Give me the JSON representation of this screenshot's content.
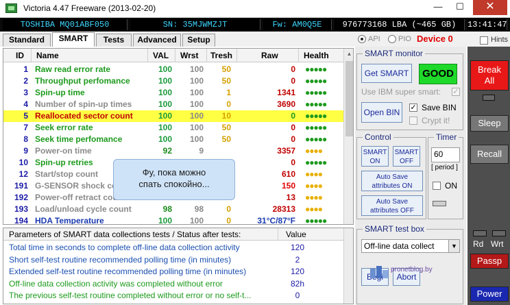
{
  "window": {
    "title": "Victoria 4.47  Freeware (2013-02-20)",
    "minimize": "—",
    "maximize": "☐",
    "close": "✕"
  },
  "info_bar": {
    "model": "TOSHIBA MQ01ABF050",
    "serial": "SN: 35MJWMZJT",
    "firmware": "Fw: AM0Q5E",
    "lba": "976773168 LBA (~465 GB)",
    "clock": "13:41:47"
  },
  "tabs": [
    {
      "label": "Standard"
    },
    {
      "label": "SMART"
    },
    {
      "label": "Tests"
    },
    {
      "label": "Advanced"
    },
    {
      "label": "Setup"
    }
  ],
  "mode": {
    "api": "API",
    "pio": "PIO",
    "device": "Device 0",
    "hints": "Hints"
  },
  "smart_table": {
    "headers": {
      "id": "ID",
      "name": "Name",
      "val": "VAL",
      "wrst": "Wrst",
      "tresh": "Tresh",
      "raw": "Raw",
      "health": "Health"
    },
    "rows": [
      {
        "id": "1",
        "name": "Raw read error rate",
        "val": "100",
        "wrst": "100",
        "tresh": "50",
        "raw": "0",
        "health": "●●●●●",
        "name_color": "#1d9a1d",
        "health_color": "#1d9a1d",
        "raw_color": "#c00000"
      },
      {
        "id": "2",
        "name": "Throughput perfomance",
        "val": "100",
        "wrst": "100",
        "tresh": "50",
        "raw": "0",
        "health": "●●●●●",
        "name_color": "#1d9a1d",
        "health_color": "#1d9a1d",
        "raw_color": "#c00000"
      },
      {
        "id": "3",
        "name": "Spin-up time",
        "val": "100",
        "wrst": "100",
        "tresh": "1",
        "raw": "1341",
        "health": "●●●●●",
        "name_color": "#1d9a1d",
        "health_color": "#1d9a1d",
        "raw_color": "#c00000"
      },
      {
        "id": "4",
        "name": "Number of spin-up times",
        "val": "100",
        "wrst": "100",
        "tresh": "0",
        "raw": "3690",
        "health": "●●●●●",
        "name_color": "#8a8a8a",
        "health_color": "#1d9a1d",
        "raw_color": "#c00000"
      },
      {
        "id": "5",
        "name": "Reallocated sector count",
        "val": "100",
        "wrst": "100",
        "tresh": "10",
        "raw": "0",
        "health": "●●●●●",
        "name_color": "#c00000",
        "health_color": "#1d9a1d",
        "raw_color": "#1d9a1d",
        "highlight": true
      },
      {
        "id": "7",
        "name": "Seek error rate",
        "val": "100",
        "wrst": "100",
        "tresh": "50",
        "raw": "0",
        "health": "●●●●●",
        "name_color": "#1d9a1d",
        "health_color": "#1d9a1d",
        "raw_color": "#c00000"
      },
      {
        "id": "8",
        "name": "Seek time perfomance",
        "val": "100",
        "wrst": "100",
        "tresh": "50",
        "raw": "0",
        "health": "●●●●●",
        "name_color": "#1d9a1d",
        "health_color": "#1d9a1d",
        "raw_color": "#c00000"
      },
      {
        "id": "9",
        "name": "Power-on time",
        "val": "92",
        "wrst": "9",
        "tresh": "",
        "raw": "3357",
        "health": "●●●●",
        "name_color": "#8a8a8a",
        "health_color": "#e8b000",
        "raw_color": "#c00000"
      },
      {
        "id": "10",
        "name": "Spin-up retries",
        "val": "",
        "wrst": "",
        "tresh": "",
        "raw": "0",
        "health": "●●●●●",
        "name_color": "#1d9a1d",
        "health_color": "#1d9a1d",
        "raw_color": "#c00000"
      },
      {
        "id": "12",
        "name": "Start/stop count",
        "val": "",
        "wrst": "",
        "tresh": "",
        "raw": "610",
        "health": "●●●●",
        "name_color": "#8a8a8a",
        "health_color": "#e8b000",
        "raw_color": "#c00000"
      },
      {
        "id": "191",
        "name": "G-SENSOR shock co",
        "val": "",
        "wrst": "",
        "tresh": "",
        "raw": "150",
        "health": "●●●●",
        "name_color": "#8a8a8a",
        "health_color": "#e8b000",
        "raw_color": "#e00000"
      },
      {
        "id": "192",
        "name": "Power-off retract coun",
        "val": "",
        "wrst": "",
        "tresh": "",
        "raw": "13",
        "health": "●●●●",
        "name_color": "#8a8a8a",
        "health_color": "#e8b000",
        "raw_color": "#c00000"
      },
      {
        "id": "193",
        "name": "Load/unload cycle count",
        "val": "98",
        "wrst": "98",
        "tresh": "0",
        "raw": "28313",
        "health": "●●●●",
        "name_color": "#8a8a8a",
        "health_color": "#e8b000",
        "raw_color": "#c00000"
      },
      {
        "id": "194",
        "name": "HDA Temperature",
        "val": "100",
        "wrst": "100",
        "tresh": "0",
        "raw": "31°C/87°F",
        "health": "●●●●●",
        "name_color": "#1a3ab0",
        "health_color": "#1d9a1d",
        "raw_color": "#1a3ab0"
      }
    ]
  },
  "bubble": {
    "line1": "Фу, пока можно",
    "line2": "спать спокойно..."
  },
  "params_table": {
    "header_param": "Parameters of SMART data collections tests / Status after tests:",
    "header_value": "Value",
    "rows": [
      {
        "text": "Total time in seconds to complete off-line data collection activity",
        "value": "120",
        "green": false
      },
      {
        "text": "Short self-test routine recommended polling time (in minutes)",
        "value": "2",
        "green": false
      },
      {
        "text": "Extended self-test routine recommended polling time (in minutes)",
        "value": "120",
        "green": false
      },
      {
        "text": "Off-line data collection activity was completed without error",
        "value": "82h",
        "green": true
      },
      {
        "text": "The previous self-test routine completed without error or no self-t...",
        "value": "0",
        "green": true
      }
    ]
  },
  "smart_monitor": {
    "title": "SMART monitor",
    "get_smart": "Get SMART",
    "status": "GOOD",
    "ibm_label": "Use IBM super smart:",
    "open_bin": "Open BIN",
    "save_bin": "Save BIN",
    "crypt": "Crypt it!"
  },
  "control": {
    "title": "Control",
    "smart_on_1": "SMART",
    "smart_on_2": "ON",
    "smart_off_1": "SMART",
    "smart_off_2": "OFF",
    "autosave_on_1": "Auto Save",
    "autosave_on_2": "attributes ON",
    "autosave_off_1": "Auto Save",
    "autosave_off_2": "attributes OFF"
  },
  "timer": {
    "title": "Timer",
    "value": "60",
    "period": "[ period ]",
    "on_label": "ON"
  },
  "test_box": {
    "title": "SMART test box",
    "selected": "Off-line data collect",
    "begin": "Begi",
    "abort": "Abort"
  },
  "right_panel": {
    "break_1": "Break",
    "break_2": "All",
    "sleep": "Sleep",
    "recall": "Recall",
    "rd": "Rd",
    "wrt": "Wrt",
    "passp": "Passp",
    "power": "Power"
  },
  "watermark": "pronetblog.by"
}
